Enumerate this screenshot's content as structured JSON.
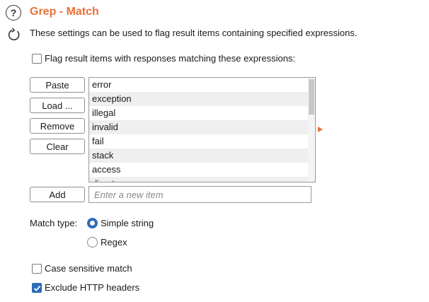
{
  "header": {
    "help_icon": "question-mark",
    "refresh_icon": "refresh",
    "help_glyph": "?",
    "title": "Grep - Match",
    "description": "These settings can be used to flag result items containing specified expressions.",
    "accent_color": "#e8703a"
  },
  "flag_checkbox": {
    "label": "Flag result items with responses matching these expressions:",
    "checked": false
  },
  "buttons": {
    "paste": "Paste",
    "load": "Load ...",
    "remove": "Remove",
    "clear": "Clear",
    "add": "Add"
  },
  "expressions": [
    "error",
    "exception",
    "illegal",
    "invalid",
    "fail",
    "stack",
    "access",
    "direct"
  ],
  "new_item": {
    "placeholder": "Enter a new item",
    "value": ""
  },
  "match_type": {
    "label": "Match type:",
    "options": [
      "Simple string",
      "Regex"
    ],
    "selected": "Simple string"
  },
  "case_sensitive": {
    "label": "Case sensitive match",
    "checked": false
  },
  "exclude_headers": {
    "label": "Exclude HTTP headers",
    "checked": true
  }
}
